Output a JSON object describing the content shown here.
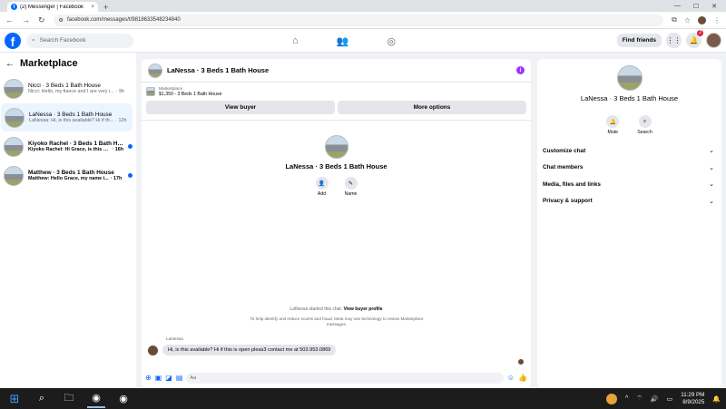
{
  "browser": {
    "tab_title": "(2) Messenger | Facebook",
    "tab_close": "×",
    "new_tab": "+",
    "url": "facebook.com/messages/t/9818633548234840",
    "win_min": "—",
    "win_max": "☐",
    "win_close": "✕"
  },
  "header": {
    "logo": "f",
    "search_placeholder": "Search Facebook",
    "find_friends": "Find friends",
    "notification_count": "2"
  },
  "left": {
    "title": "Marketplace",
    "conversations": [
      {
        "name": "Nicci · 3 Beds 1 Bath House",
        "preview": "Nicci: Hello, my fiance and I are very i...",
        "time": "· 9h",
        "unread": false
      },
      {
        "name": "LaNessa · 3 Beds 1 Bath House",
        "preview": "LaNessa: Hi, is this available? Hi if th...",
        "time": "· 12h",
        "unread": false
      },
      {
        "name": "Kiyoko Rachel · 3 Beds 1 Bath Ho...",
        "preview": "Kiyoko Rachel: Hi Grace, is this sti...",
        "time": "· 16h",
        "unread": true
      },
      {
        "name": "Matthew · 3 Beds 1 Bath House",
        "preview": "Matthew: Hello Grace, my name i...",
        "time": "· 17h",
        "unread": true
      }
    ]
  },
  "chat": {
    "title": "LaNessa · 3 Beds 1 Bath House",
    "marketplace_label": "Marketplace",
    "listing_price": "$1,350 - 3 Beds 1 Bath House",
    "view_buyer": "View buyer",
    "more_options": "More options",
    "profile_name": "LaNessa · 3 Beds 1 Bath House",
    "add_label": "Add",
    "name_label": "Name",
    "started_text": "LaNessa started this chat.",
    "view_buyer_profile": "View buyer profile",
    "meta_note": "To help identify and reduce scams and fraud, Meta may use technology to review Marketplace messages.",
    "sender": "LaNessa",
    "message": "Hi, is this available? Hi if this is open pleas3 contact me at 503.953.0869",
    "composer_placeholder": "Aa"
  },
  "right": {
    "name": "LaNessa · 3 Beds 1 Bath House",
    "mute": "Mute",
    "search": "Search",
    "sections": [
      "Customize chat",
      "Chat members",
      "Media, files and links",
      "Privacy & support"
    ]
  },
  "taskbar": {
    "time": "11:29 PM",
    "date": "8/9/2025"
  },
  "colors": {
    "accent": "#0866ff",
    "info": "#a033ff",
    "badge": "#e41e3f"
  }
}
